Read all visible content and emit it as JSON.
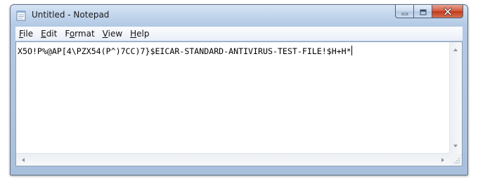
{
  "window": {
    "title": "Untitled - Notepad",
    "accent_color": "#b4c9e4",
    "close_color": "#c2391c"
  },
  "menu": {
    "items": [
      {
        "accel": "F",
        "rest": "ile"
      },
      {
        "accel": "E",
        "rest": "dit"
      },
      {
        "pre": "F",
        "accel": "o",
        "rest": "rmat"
      },
      {
        "accel": "V",
        "rest": "iew"
      },
      {
        "accel": "H",
        "rest": "elp"
      }
    ]
  },
  "editor": {
    "text": "X5O!P%@AP[4\\PZX54(P^)7CC)7}$EICAR-STANDARD-ANTIVIRUS-TEST-FILE!$H+H*"
  },
  "icons": {
    "app": "notepad-icon",
    "minimize": "minimize-icon",
    "maximize": "maximize-icon",
    "close": "close-icon"
  }
}
